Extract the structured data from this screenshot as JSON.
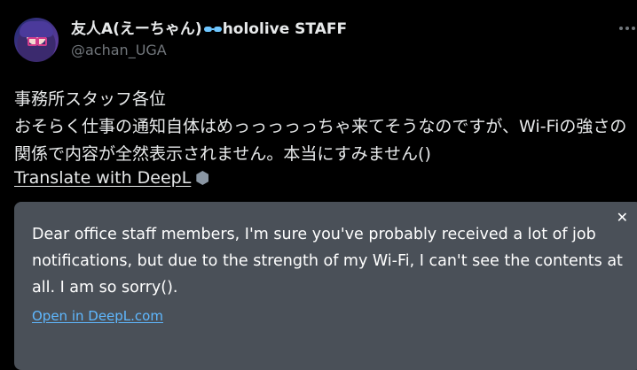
{
  "user": {
    "display_name_prefix": "友人A(えーちゃん)",
    "glasses_emoji": "👓",
    "display_name_suffix": "hololive STAFF",
    "handle": "@achan_UGA"
  },
  "tweet": {
    "text": "事務所スタッフ各位\nおそらく仕事の通知自体はめっっっっっちゃ来てそうなのですが、Wi-Fiの強さの関係で内容が全然表示されません。本当にすみません()"
  },
  "translate": {
    "link_label": "Translate with DeepL"
  },
  "translation": {
    "close_label": "✕",
    "text": "Dear office staff members, I'm sure you've probably received a lot of job notifications, but due to the strength of my Wi-Fi, I can't see the contents at all. I am so sorry().",
    "open_link_label": "Open in DeepL.com"
  },
  "colors": {
    "background": "#000000",
    "translation_box": "#4a5058",
    "link_blue": "#5fb8ff",
    "muted_text": "#71767b"
  }
}
